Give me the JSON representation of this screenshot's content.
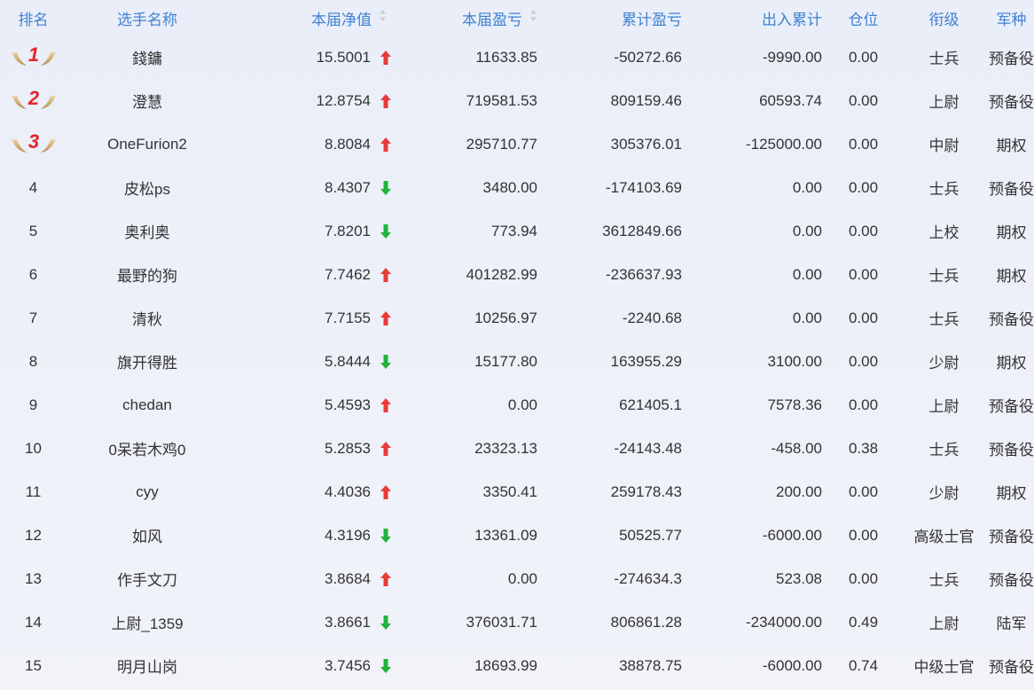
{
  "columns": {
    "rank": "排名",
    "name": "选手名称",
    "net": "本届净值",
    "pl": "本届盈亏",
    "cum_pl": "累计盈亏",
    "flow": "出入累计",
    "position": "仓位",
    "rank_title": "衔级",
    "army": "军种"
  },
  "colors": {
    "up": "#e83a3a",
    "down": "#1fb33a",
    "header": "#3f82d2"
  },
  "rows": [
    {
      "rank": "1",
      "name": "錢鏞",
      "net": "15.5001",
      "trend": "up",
      "pl": "11633.85",
      "cum_pl": "-50272.66",
      "flow": "-9990.00",
      "position": "0.00",
      "title": "士兵",
      "army": "预备役"
    },
    {
      "rank": "2",
      "name": "澄慧",
      "net": "12.8754",
      "trend": "up",
      "pl": "719581.53",
      "cum_pl": "809159.46",
      "flow": "60593.74",
      "position": "0.00",
      "title": "上尉",
      "army": "预备役"
    },
    {
      "rank": "3",
      "name": "OneFurion2",
      "net": "8.8084",
      "trend": "up",
      "pl": "295710.77",
      "cum_pl": "305376.01",
      "flow": "-125000.00",
      "position": "0.00",
      "title": "中尉",
      "army": "期权"
    },
    {
      "rank": "4",
      "name": "皮松ps",
      "net": "8.4307",
      "trend": "down",
      "pl": "3480.00",
      "cum_pl": "-174103.69",
      "flow": "0.00",
      "position": "0.00",
      "title": "士兵",
      "army": "预备役"
    },
    {
      "rank": "5",
      "name": "奥利奥",
      "net": "7.8201",
      "trend": "down",
      "pl": "773.94",
      "cum_pl": "3612849.66",
      "flow": "0.00",
      "position": "0.00",
      "title": "上校",
      "army": "期权"
    },
    {
      "rank": "6",
      "name": "最野的狗",
      "net": "7.7462",
      "trend": "up",
      "pl": "401282.99",
      "cum_pl": "-236637.93",
      "flow": "0.00",
      "position": "0.00",
      "title": "士兵",
      "army": "期权"
    },
    {
      "rank": "7",
      "name": "清秋",
      "net": "7.7155",
      "trend": "up",
      "pl": "10256.97",
      "cum_pl": "-2240.68",
      "flow": "0.00",
      "position": "0.00",
      "title": "士兵",
      "army": "预备役"
    },
    {
      "rank": "8",
      "name": "旗开得胜",
      "net": "5.8444",
      "trend": "down",
      "pl": "15177.80",
      "cum_pl": "163955.29",
      "flow": "3100.00",
      "position": "0.00",
      "title": "少尉",
      "army": "期权"
    },
    {
      "rank": "9",
      "name": "chedan",
      "net": "5.4593",
      "trend": "up",
      "pl": "0.00",
      "cum_pl": "621405.1",
      "flow": "7578.36",
      "position": "0.00",
      "title": "上尉",
      "army": "预备役"
    },
    {
      "rank": "10",
      "name": "0呆若木鸡0",
      "net": "5.2853",
      "trend": "up",
      "pl": "23323.13",
      "cum_pl": "-24143.48",
      "flow": "-458.00",
      "position": "0.38",
      "title": "士兵",
      "army": "预备役"
    },
    {
      "rank": "11",
      "name": "cyy",
      "net": "4.4036",
      "trend": "up",
      "pl": "3350.41",
      "cum_pl": "259178.43",
      "flow": "200.00",
      "position": "0.00",
      "title": "少尉",
      "army": "期权"
    },
    {
      "rank": "12",
      "name": "如风",
      "net": "4.3196",
      "trend": "down",
      "pl": "13361.09",
      "cum_pl": "50525.77",
      "flow": "-6000.00",
      "position": "0.00",
      "title": "高级士官",
      "army": "预备役"
    },
    {
      "rank": "13",
      "name": "作手文刀",
      "net": "3.8684",
      "trend": "up",
      "pl": "0.00",
      "cum_pl": "-274634.3",
      "flow": "523.08",
      "position": "0.00",
      "title": "士兵",
      "army": "预备役"
    },
    {
      "rank": "14",
      "name": "上尉_1359",
      "net": "3.8661",
      "trend": "down",
      "pl": "376031.71",
      "cum_pl": "806861.28",
      "flow": "-234000.00",
      "position": "0.49",
      "title": "上尉",
      "army": "陆军"
    },
    {
      "rank": "15",
      "name": "明月山岗",
      "net": "3.7456",
      "trend": "down",
      "pl": "18693.99",
      "cum_pl": "38878.75",
      "flow": "-6000.00",
      "position": "0.74",
      "title": "中级士官",
      "army": "预备役"
    }
  ]
}
